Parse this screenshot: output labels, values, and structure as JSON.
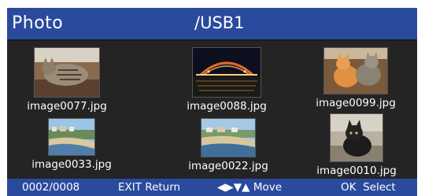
{
  "header": {
    "title": "Photo",
    "path": "/USB1"
  },
  "items": [
    {
      "name": "image0077.jpg",
      "thumb": "cat-on-blanket-icon"
    },
    {
      "name": "image0088.jpg",
      "thumb": "bridge-at-night-icon"
    },
    {
      "name": "image0099.jpg",
      "thumb": "two-cats-icon"
    },
    {
      "name": "image0033.jpg",
      "thumb": "beach-town-icon"
    },
    {
      "name": "image0022.jpg",
      "thumb": "coast-town-icon"
    },
    {
      "name": "image0010.jpg",
      "thumb": "black-cat-icon"
    }
  ],
  "footer": {
    "page": "0002/0008",
    "exit_key": "EXIT",
    "exit_label": "Return",
    "move_arrows": "◀▶▼▲",
    "move_label": "Move",
    "ok_key": "OK",
    "ok_label": "Select"
  },
  "colors": {
    "bar": "#2a4a9e",
    "panel": "#242424",
    "text": "#ffffff"
  }
}
